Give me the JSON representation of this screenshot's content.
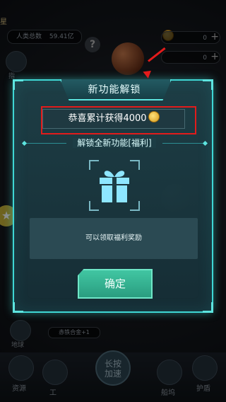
{
  "hud": {
    "top_left_label": "星",
    "population_label": "人类总数",
    "population_value": "59.41亿",
    "help_label": "?",
    "res_value_1": "0",
    "res_value_2": "0",
    "plus": "+",
    "side_left_label": "指",
    "ore_label": "赤铁合金+1",
    "earth_label": "地球",
    "boost_line1": "长按",
    "boost_line2": "加速",
    "bottom": [
      "资源",
      "工",
      "",
      "船坞",
      "护盾"
    ]
  },
  "dialog": {
    "title": "新功能解锁",
    "message": "恭喜累计获得4000",
    "section_title": "解锁全新功能[福利]",
    "description": "可以领取福利奖励",
    "confirm_label": "确定"
  },
  "colors": {
    "accent": "#3fd7d4",
    "confirm": "#41c6a2",
    "highlight_frame": "#e21b1b",
    "gift": "#8ee6ff"
  },
  "icons": {
    "coin": "coin-icon",
    "gift": "gift-icon"
  }
}
